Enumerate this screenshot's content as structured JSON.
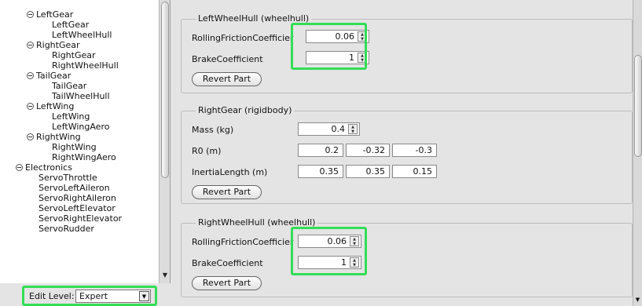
{
  "tree": {
    "items": [
      {
        "label": "LeftGear",
        "expanded": true
      },
      {
        "label": "LeftGear"
      },
      {
        "label": "LeftWheelHull"
      },
      {
        "label": "RightGear",
        "expanded": true
      },
      {
        "label": "RightGear"
      },
      {
        "label": "RightWheelHull"
      },
      {
        "label": "TailGear",
        "expanded": true
      },
      {
        "label": "TailGear"
      },
      {
        "label": "TailWheelHull"
      },
      {
        "label": "LeftWing",
        "expanded": true
      },
      {
        "label": "LeftWing"
      },
      {
        "label": "LeftWingAero"
      },
      {
        "label": "RightWing",
        "expanded": true
      },
      {
        "label": "RightWing"
      },
      {
        "label": "RightWingAero"
      },
      {
        "label": "Electronics",
        "expanded": true
      },
      {
        "label": "ServoThrottle"
      },
      {
        "label": "ServoLeftAileron"
      },
      {
        "label": "ServoRightAileron"
      },
      {
        "label": "ServoLeftElevator"
      },
      {
        "label": "ServoRightElevator"
      },
      {
        "label": "ServoRudder"
      }
    ]
  },
  "edit_level": {
    "label": "Edit Level:",
    "value": "Expert"
  },
  "groups": {
    "left_wheel_hull": {
      "title": "LeftWheelHull (wheelhull)",
      "rolling_label": "RollingFrictionCoefficier",
      "rolling_value": "0.06",
      "brake_label": "BrakeCoefficient",
      "brake_value": "1",
      "revert_label": "Revert Part"
    },
    "right_gear": {
      "title": "RightGear (rigidbody)",
      "mass_label": "Mass (kg)",
      "mass_value": "0.4",
      "r0_label": "R0 (m)",
      "r0_values": [
        "0.2",
        "-0.32",
        "-0.3"
      ],
      "inertia_label": "InertiaLength (m)",
      "inertia_values": [
        "0.35",
        "0.35",
        "0.15"
      ],
      "revert_label": "Revert Part"
    },
    "right_wheel_hull": {
      "title": "RightWheelHull (wheelhull)",
      "rolling_label": "RollingFrictionCoefficier",
      "rolling_value": "0.06",
      "brake_label": "BrakeCoefficient",
      "brake_value": "1",
      "revert_label": "Revert Part"
    }
  },
  "colors": {
    "highlight": "#33dd55"
  }
}
